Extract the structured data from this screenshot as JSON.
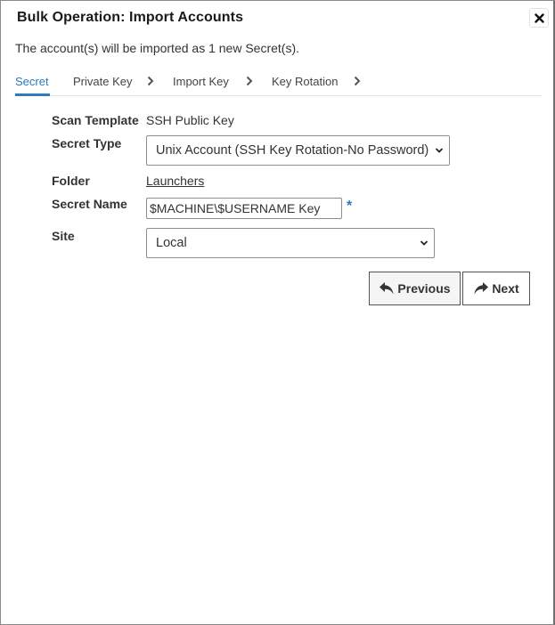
{
  "dialog": {
    "title": "Bulk Operation: Import Accounts",
    "description": "The account(s) will be imported as 1 new Secret(s).",
    "close_icon": "close-icon"
  },
  "tabs": [
    {
      "label": "Secret",
      "active": true
    },
    {
      "label": "Private Key",
      "active": false
    },
    {
      "label": "Import Key",
      "active": false
    },
    {
      "label": "Key Rotation",
      "active": false
    }
  ],
  "form": {
    "scan_template": {
      "label": "Scan Template",
      "value": "SSH Public Key"
    },
    "secret_type": {
      "label": "Secret Type",
      "selected": "Unix Account (SSH Key Rotation-No Password)"
    },
    "folder": {
      "label": "Folder",
      "value": "Launchers"
    },
    "secret_name": {
      "label": "Secret Name",
      "value": "$MACHINE\\$USERNAME Key",
      "required_marker": "*"
    },
    "site": {
      "label": "Site",
      "selected": "Local"
    }
  },
  "buttons": {
    "previous": {
      "label": "Previous",
      "icon": "reply-arrow-icon"
    },
    "next": {
      "label": "Next",
      "icon": "forward-arrow-icon"
    }
  },
  "colors": {
    "accent": "#2a7bbf",
    "text": "#333333",
    "border": "#8f8f8f"
  }
}
